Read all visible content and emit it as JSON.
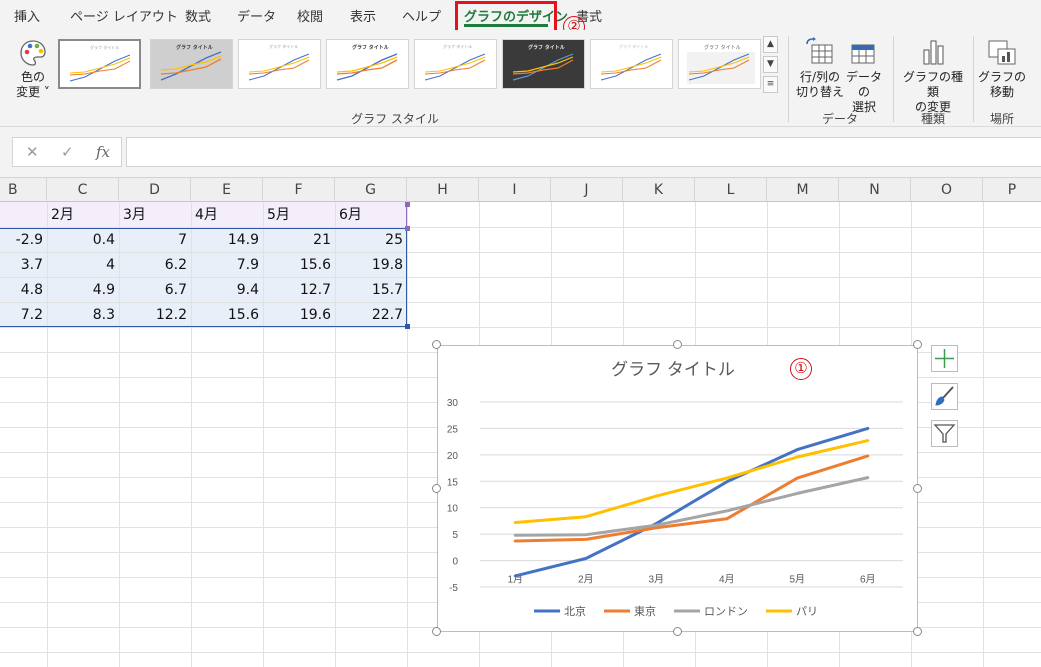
{
  "tabs": [
    {
      "label": "挿入"
    },
    {
      "label": "ページ レイアウト"
    },
    {
      "label": "数式"
    },
    {
      "label": "データ"
    },
    {
      "label": "校閲"
    },
    {
      "label": "表示"
    },
    {
      "label": "ヘルプ"
    },
    {
      "label": "グラフのデザイン",
      "active": true
    },
    {
      "label": "書式"
    }
  ],
  "annotations": {
    "chart_marker": "①",
    "tab_marker": "②",
    "highlight_color": "#e8101c"
  },
  "ribbon": {
    "color_button": {
      "line1": "色の",
      "line2": "変更"
    },
    "gallery_group_label": "グラフ スタイル",
    "data_group": {
      "label": "データ",
      "switch_row_col": {
        "line1": "行/列の",
        "line2": "切り替え"
      },
      "select_data": {
        "line1": "データの",
        "line2": "選択"
      }
    },
    "type_group": {
      "label": "種類",
      "change_type": {
        "line1": "グラフの種類",
        "line2": "の変更"
      }
    },
    "location_group": {
      "label": "場所",
      "move_chart": {
        "line1": "グラフの",
        "line2": "移動"
      }
    }
  },
  "formula_bar": {
    "cancel_icon": "✕",
    "enter_icon": "✓",
    "fx_icon": "fx",
    "value": ""
  },
  "columns": [
    "B",
    "C",
    "D",
    "E",
    "F",
    "G",
    "H",
    "I",
    "J",
    "K",
    "L",
    "M",
    "N",
    "O",
    "P"
  ],
  "sheet": {
    "header_row": [
      "",
      "2月",
      "3月",
      "4月",
      "5月",
      "6月"
    ],
    "rows": [
      [
        "-2.9",
        "0.4",
        "7",
        "14.9",
        "21",
        "25"
      ],
      [
        "3.7",
        "4",
        "6.2",
        "7.9",
        "15.6",
        "19.8"
      ],
      [
        "4.8",
        "4.9",
        "6.7",
        "9.4",
        "12.7",
        "15.7"
      ],
      [
        "7.2",
        "8.3",
        "12.2",
        "15.6",
        "19.6",
        "22.7"
      ]
    ]
  },
  "chart_data": {
    "type": "line",
    "title": "グラフ タイトル",
    "categories": [
      "1月",
      "2月",
      "3月",
      "4月",
      "5月",
      "6月"
    ],
    "series": [
      {
        "name": "北京",
        "color": "#4472c4",
        "values": [
          -2.9,
          0.4,
          7,
          14.9,
          21,
          25
        ]
      },
      {
        "name": "東京",
        "color": "#ed7d31",
        "values": [
          3.7,
          4,
          6.2,
          7.9,
          15.6,
          19.8
        ]
      },
      {
        "name": "ロンドン",
        "color": "#a5a5a5",
        "values": [
          4.8,
          4.9,
          6.7,
          9.4,
          12.7,
          15.7
        ]
      },
      {
        "name": "パリ",
        "color": "#ffc000",
        "values": [
          7.2,
          8.3,
          12.2,
          15.6,
          19.6,
          22.7
        ]
      }
    ],
    "yticks": [
      "30",
      "25",
      "20",
      "15",
      "10",
      "5",
      "0",
      "-5"
    ],
    "ylim": [
      -5,
      30
    ],
    "grid": true,
    "legend": "bottom"
  }
}
